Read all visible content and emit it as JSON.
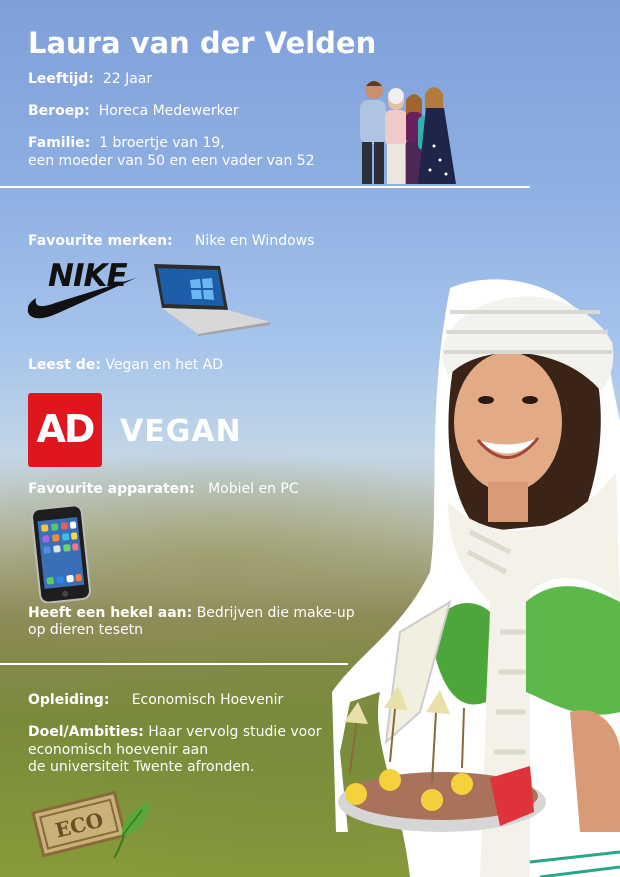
{
  "profile": {
    "name": "Laura van der Velden",
    "age_label": "Leeftijd:",
    "age_value": "22 Jaar",
    "job_label": "Beroep:",
    "job_value": "Horeca Medewerker",
    "family_label": "Familie:",
    "family_value_1": "1 broertje van 19,",
    "family_value_2": "een moeder van 50  en een vader van 52"
  },
  "brands": {
    "label": "Favourite merken:",
    "value": "Nike en Windows",
    "nike_logo_text": "NIKE"
  },
  "reads": {
    "label": "Leest de:",
    "value": "Vegan en het AD",
    "ad_logo_text": "AD",
    "vegan_logo_text": "VEGAN"
  },
  "devices": {
    "label": "Favourite apparaten:",
    "value": "Mobiel en PC"
  },
  "dislike": {
    "label": "Heeft een hekel aan:",
    "value_1": "Bedrijven die make-up",
    "value_2": "op dieren tesetn"
  },
  "education": {
    "label": "Opleiding:",
    "value": "Economisch Hoevenir"
  },
  "goals": {
    "label": "Doel/Ambities:",
    "value_1": "Haar vervolg studie voor",
    "value_2": "economisch hoevenir aan",
    "value_3": "de universiteit Twente afronden."
  },
  "eco_stamp": {
    "text": "ECO"
  },
  "colors": {
    "sky_top": "#7f9fd9",
    "ad_red": "#e0161e",
    "text": "#ffffff"
  }
}
